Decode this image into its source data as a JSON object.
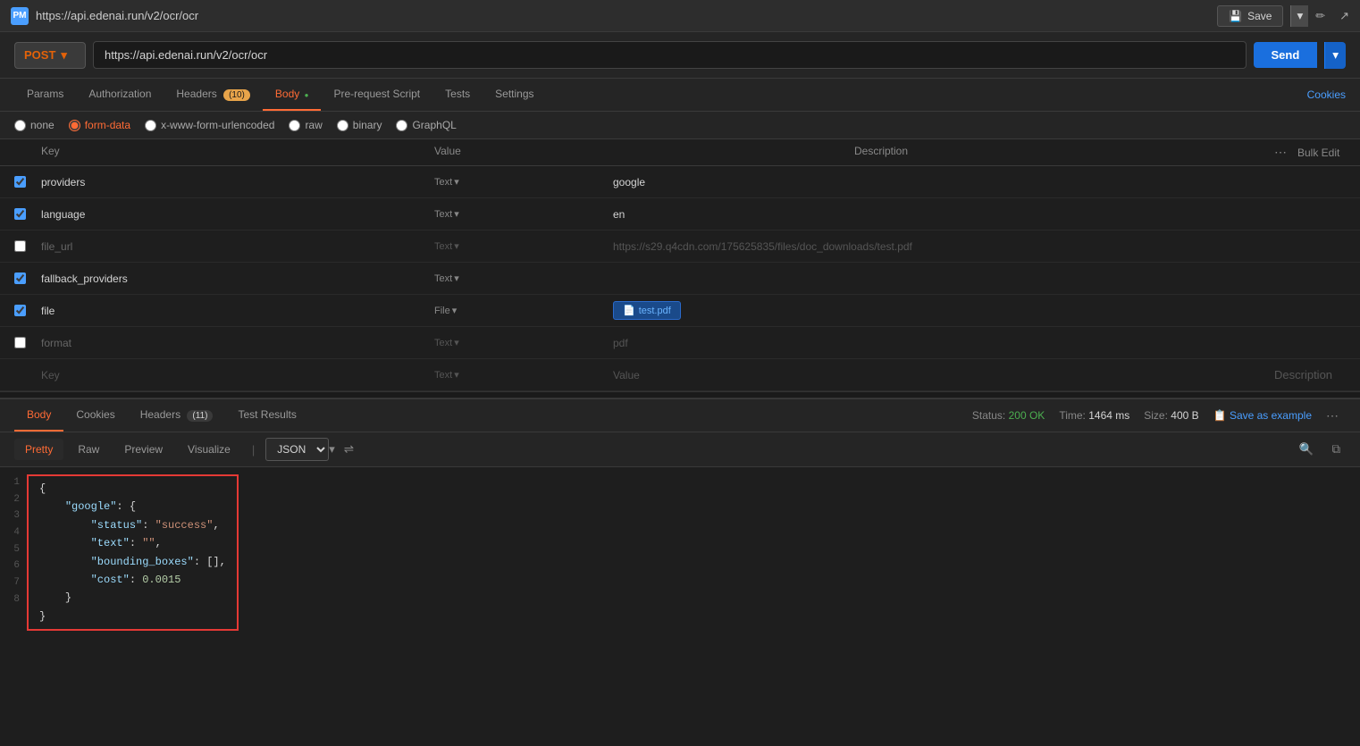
{
  "titleBar": {
    "url": "https://api.edenai.run/v2/ocr/ocr",
    "saveLabel": "Save",
    "editIcon": "✏",
    "shareIcon": "↗"
  },
  "urlBar": {
    "method": "POST",
    "url": "https://api.edenai.run/v2/ocr/ocr",
    "sendLabel": "Send"
  },
  "reqTabs": {
    "params": "Params",
    "authorization": "Authorization",
    "headers": "Headers",
    "headersCount": "(10)",
    "body": "Body",
    "preRequestScript": "Pre-request Script",
    "tests": "Tests",
    "settings": "Settings",
    "cookies": "Cookies"
  },
  "bodyOptions": {
    "none": "none",
    "formData": "form-data",
    "xWwwFormUrlencoded": "x-www-form-urlencoded",
    "raw": "raw",
    "binary": "binary",
    "graphql": "GraphQL"
  },
  "tableHeaders": {
    "checkbox": "",
    "key": "Key",
    "value": "Value",
    "description": "Description",
    "bulkEdit": "Bulk Edit"
  },
  "tableRows": [
    {
      "id": "row1",
      "checked": true,
      "key": "providers",
      "type": "Text",
      "value": "google",
      "description": ""
    },
    {
      "id": "row2",
      "checked": true,
      "key": "language",
      "type": "Text",
      "value": "en",
      "description": ""
    },
    {
      "id": "row3",
      "checked": false,
      "key": "file_url",
      "type": "Text",
      "value": "https://s29.q4cdn.com/175625835/files/doc_downloads/test.pdf",
      "description": "",
      "dimmed": true
    },
    {
      "id": "row4",
      "checked": true,
      "key": "fallback_providers",
      "type": "Text",
      "value": "",
      "description": ""
    },
    {
      "id": "row5",
      "checked": true,
      "key": "file",
      "type": "File",
      "value": "test.pdf",
      "description": "",
      "isFile": true
    },
    {
      "id": "row6",
      "checked": false,
      "key": "format",
      "type": "Text",
      "value": "pdf",
      "description": "",
      "dimmed": true
    }
  ],
  "emptyRow": {
    "keyPlaceholder": "Key",
    "typePlaceholder": "Text",
    "valuePlaceholder": "Value",
    "descPlaceholder": "Description"
  },
  "responseTabs": {
    "body": "Body",
    "cookies": "Cookies",
    "headers": "Headers",
    "headersCount": "(11)",
    "testResults": "Test Results"
  },
  "responseStatus": {
    "label": "Status:",
    "statusText": "200 OK",
    "timeLabel": "Time:",
    "timeValue": "1464 ms",
    "sizeLabel": "Size:",
    "sizeValue": "400 B",
    "saveExample": "Save as example"
  },
  "formatTabs": {
    "pretty": "Pretty",
    "raw": "Raw",
    "preview": "Preview",
    "visualize": "Visualize",
    "jsonFormat": "JSON"
  },
  "jsonResponse": {
    "line1": "{",
    "line2": "  \"google\": {",
    "line3": "    \"status\": \"success\",",
    "line4": "    \"text\": \"\",",
    "line5": "    \"bounding_boxes\": [],",
    "line6": "    \"cost\": 0.0015",
    "line7": "  }",
    "line8": "}"
  }
}
